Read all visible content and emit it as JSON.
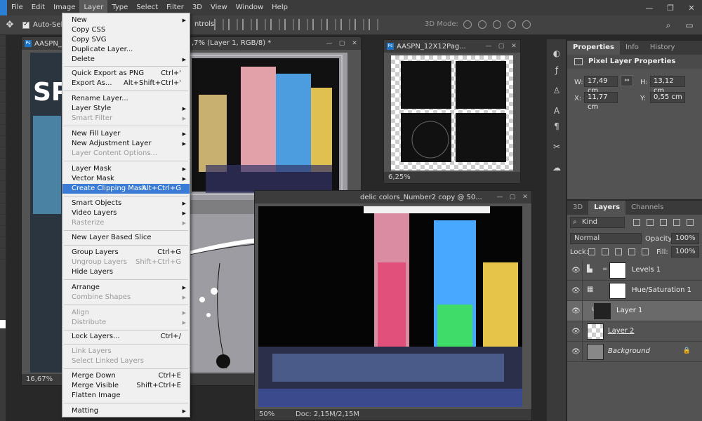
{
  "menubar": {
    "items": [
      {
        "label": "File"
      },
      {
        "label": "Edit"
      },
      {
        "label": "Image"
      },
      {
        "label": "Layer"
      },
      {
        "label": "Type"
      },
      {
        "label": "Select"
      },
      {
        "label": "Filter"
      },
      {
        "label": "3D"
      },
      {
        "label": "View"
      },
      {
        "label": "Window"
      },
      {
        "label": "Help"
      }
    ],
    "active": "Layer"
  },
  "options_bar": {
    "auto_select_label": "Auto-Sele",
    "controls_label": "ntrols",
    "mode_3d_label": "3D Mode:"
  },
  "layer_menu": {
    "items": [
      {
        "label": "New",
        "shortcut": "",
        "submenu": true,
        "disabled": false
      },
      {
        "label": "Copy CSS",
        "shortcut": "",
        "submenu": false,
        "disabled": false
      },
      {
        "label": "Copy SVG",
        "shortcut": "",
        "submenu": false,
        "disabled": false
      },
      {
        "label": "Duplicate Layer...",
        "shortcut": "",
        "submenu": false,
        "disabled": false
      },
      {
        "label": "Delete",
        "shortcut": "",
        "submenu": true,
        "disabled": false
      },
      {
        "label": "Quick Export as PNG",
        "shortcut": "Ctrl+'",
        "submenu": false,
        "disabled": false
      },
      {
        "label": "Export As...",
        "shortcut": "Alt+Shift+Ctrl+'",
        "submenu": false,
        "disabled": false
      },
      {
        "label": "Rename Layer...",
        "shortcut": "",
        "submenu": false,
        "disabled": false
      },
      {
        "label": "Layer Style",
        "shortcut": "",
        "submenu": true,
        "disabled": false
      },
      {
        "label": "Smart Filter",
        "shortcut": "",
        "submenu": true,
        "disabled": true
      },
      {
        "label": "New Fill Layer",
        "shortcut": "",
        "submenu": true,
        "disabled": false
      },
      {
        "label": "New Adjustment Layer",
        "shortcut": "",
        "submenu": true,
        "disabled": false
      },
      {
        "label": "Layer Content Options...",
        "shortcut": "",
        "submenu": false,
        "disabled": true
      },
      {
        "label": "Layer Mask",
        "shortcut": "",
        "submenu": true,
        "disabled": false
      },
      {
        "label": "Vector Mask",
        "shortcut": "",
        "submenu": true,
        "disabled": false
      },
      {
        "label": "Create Clipping Mask",
        "shortcut": "Alt+Ctrl+G",
        "submenu": false,
        "disabled": false,
        "highlighted": true
      },
      {
        "label": "Smart Objects",
        "shortcut": "",
        "submenu": true,
        "disabled": false
      },
      {
        "label": "Video Layers",
        "shortcut": "",
        "submenu": true,
        "disabled": false
      },
      {
        "label": "Rasterize",
        "shortcut": "",
        "submenu": true,
        "disabled": true
      },
      {
        "label": "New Layer Based Slice",
        "shortcut": "",
        "submenu": false,
        "disabled": false
      },
      {
        "label": "Group Layers",
        "shortcut": "Ctrl+G",
        "submenu": false,
        "disabled": false
      },
      {
        "label": "Ungroup Layers",
        "shortcut": "Shift+Ctrl+G",
        "submenu": false,
        "disabled": true
      },
      {
        "label": "Hide Layers",
        "shortcut": "",
        "submenu": false,
        "disabled": false
      },
      {
        "label": "Arrange",
        "shortcut": "",
        "submenu": true,
        "disabled": false
      },
      {
        "label": "Combine Shapes",
        "shortcut": "",
        "submenu": true,
        "disabled": true
      },
      {
        "label": "Align",
        "shortcut": "",
        "submenu": true,
        "disabled": true
      },
      {
        "label": "Distribute",
        "shortcut": "",
        "submenu": true,
        "disabled": true
      },
      {
        "label": "Lock Layers...",
        "shortcut": "Ctrl+/",
        "submenu": false,
        "disabled": false
      },
      {
        "label": "Link Layers",
        "shortcut": "",
        "submenu": false,
        "disabled": true
      },
      {
        "label": "Select Linked Layers",
        "shortcut": "",
        "submenu": false,
        "disabled": true
      },
      {
        "label": "Merge Down",
        "shortcut": "Ctrl+E",
        "submenu": false,
        "disabled": false
      },
      {
        "label": "Merge Visible",
        "shortcut": "Shift+Ctrl+E",
        "submenu": false,
        "disabled": false
      },
      {
        "label": "Flatten Image",
        "shortcut": "",
        "submenu": false,
        "disabled": false
      },
      {
        "label": "Matting",
        "shortcut": "",
        "submenu": true,
        "disabled": false
      }
    ]
  },
  "documents": {
    "main": {
      "title_left": "AASPN_",
      "title_right": ",7% (Layer 1, RGB/8) *",
      "zoom": "16,67%"
    },
    "pattern": {
      "title": "AASPN_12X12Pag...",
      "zoom": "6,25%"
    },
    "photo": {
      "title": "delic colors_Number2 copy @ 50...",
      "zoom": "50%",
      "doc_size": "Doc: 2,15M/2,15M"
    }
  },
  "properties_panel": {
    "tabs": [
      "Properties",
      "Info",
      "History"
    ],
    "active_tab": "Properties",
    "header": "Pixel Layer Properties",
    "w_label": "W:",
    "w_value": "17,49 cm",
    "h_label": "H:",
    "h_value": "13,12 cm",
    "x_label": "X:",
    "x_value": "11,77 cm",
    "y_label": "Y:",
    "y_value": "0,55 cm",
    "link_glyph": "⇔"
  },
  "layers_panel": {
    "tabs": [
      "3D",
      "Layers",
      "Channels"
    ],
    "active_tab": "Layers",
    "filter_kind": "Kind",
    "blend_mode": "Normal",
    "opacity_label": "Opacity:",
    "opacity_value": "100%",
    "lock_label": "Lock:",
    "fill_label": "Fill:",
    "fill_value": "100%",
    "layers": [
      {
        "name": "Levels 1"
      },
      {
        "name": "Hue/Saturation 1"
      },
      {
        "name": "Layer 1"
      },
      {
        "name": "Layer 2"
      },
      {
        "name": "Background"
      }
    ]
  }
}
